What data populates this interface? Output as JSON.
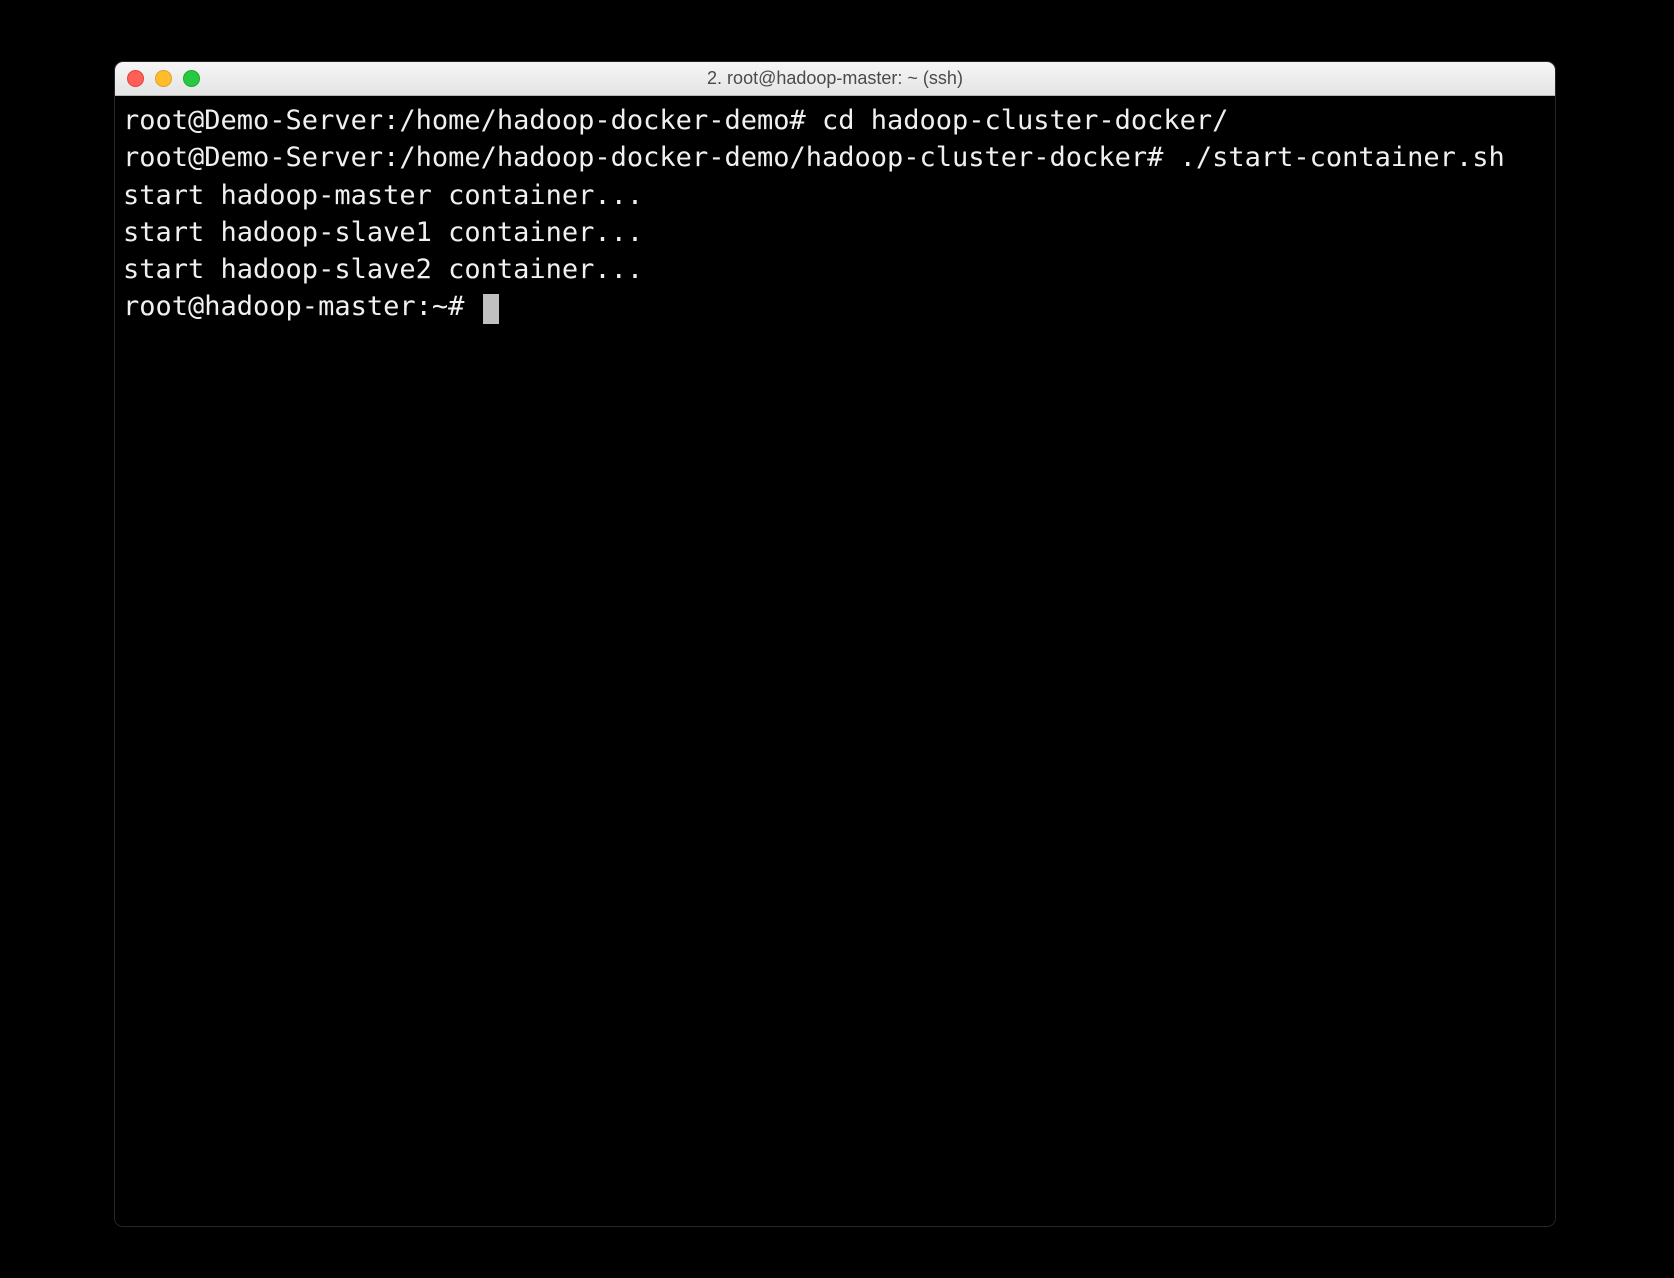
{
  "window": {
    "title": "2. root@hadoop-master: ~ (ssh)"
  },
  "terminal": {
    "lines": [
      "root@Demo-Server:/home/hadoop-docker-demo# cd hadoop-cluster-docker/",
      "root@Demo-Server:/home/hadoop-docker-demo/hadoop-cluster-docker# ./start-container.sh",
      "start hadoop-master container...",
      "start hadoop-slave1 container...",
      "start hadoop-slave2 container..."
    ],
    "prompt": "root@hadoop-master:~# "
  }
}
